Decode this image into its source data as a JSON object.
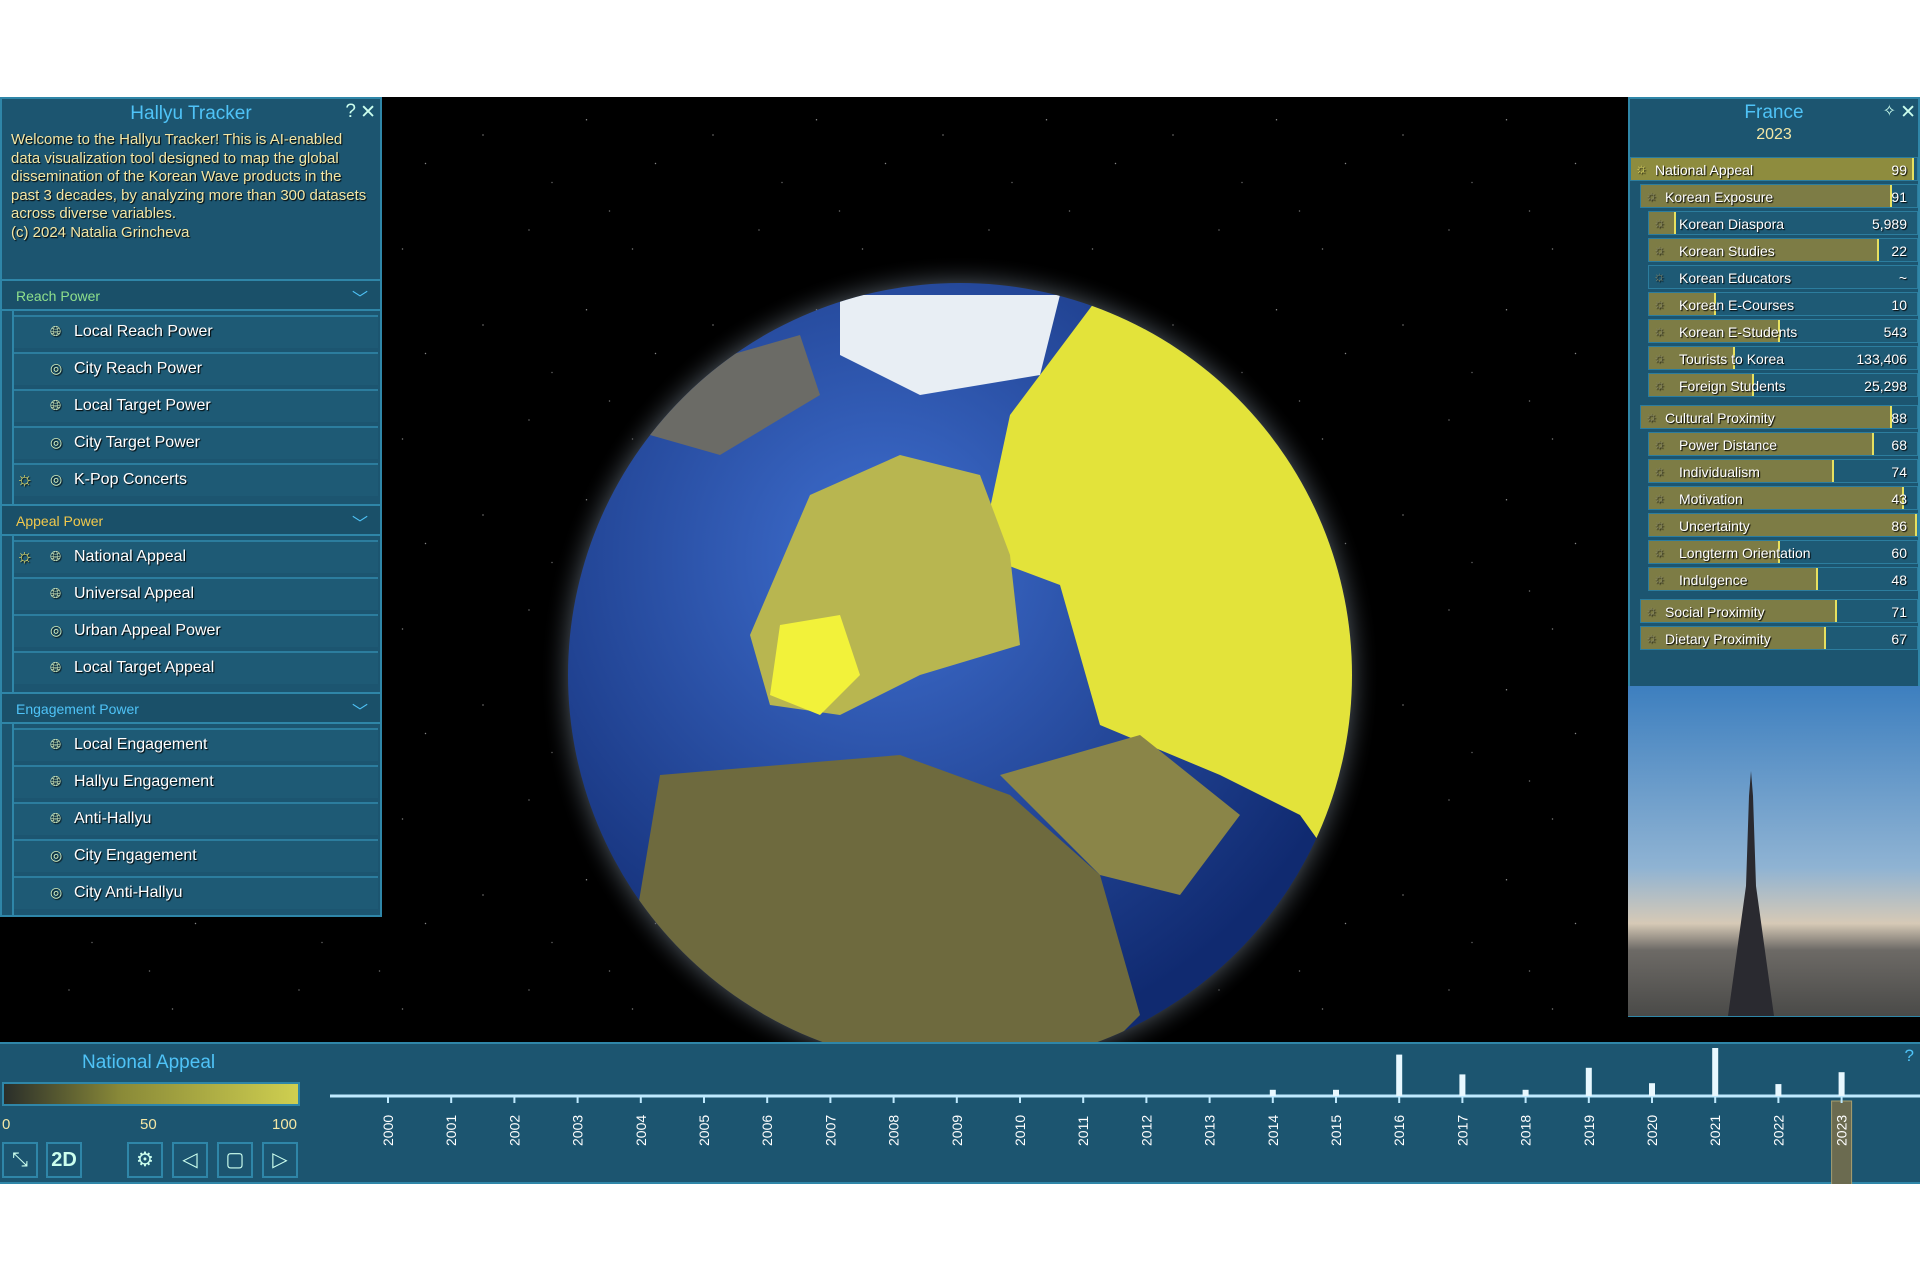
{
  "left_panel": {
    "title": "Hallyu Tracker",
    "help_icon": "?",
    "close_icon": "✕",
    "welcome": "Welcome to the Hallyu Tracker! This is AI-enabled data visualization tool designed to map the global dissemination of the Korean Wave products in the past 3 decades, by analyzing more than 300 datasets across diverse variables.",
    "copyright": "(c) 2024 Natalia Grincheva",
    "sections": [
      {
        "label": "Reach Power",
        "color": "#8fe08c",
        "items": [
          {
            "label": "Local Reach Power",
            "icon": "globe-icon",
            "active": false
          },
          {
            "label": "City Reach Power",
            "icon": "location-pin-icon",
            "active": false
          },
          {
            "label": "Local Target Power",
            "icon": "globe-icon",
            "active": false
          },
          {
            "label": "City Target Power",
            "icon": "location-pin-icon",
            "active": false
          },
          {
            "label": "K-Pop Concerts",
            "icon": "location-pin-icon",
            "active": true
          }
        ]
      },
      {
        "label": "Appeal Power",
        "color": "#f2c94c",
        "items": [
          {
            "label": "National Appeal",
            "icon": "globe-icon",
            "active": true
          },
          {
            "label": "Universal Appeal",
            "icon": "globe-icon",
            "active": false
          },
          {
            "label": "Urban Appeal Power",
            "icon": "location-pin-icon",
            "active": false
          },
          {
            "label": "Local Target Appeal",
            "icon": "globe-icon",
            "active": false
          }
        ]
      },
      {
        "label": "Engagement Power",
        "color": "#4fc3f7",
        "items": [
          {
            "label": "Local Engagement",
            "icon": "globe-icon",
            "active": false
          },
          {
            "label": "Hallyu Engagement",
            "icon": "globe-icon",
            "active": false
          },
          {
            "label": "Anti-Hallyu",
            "icon": "globe-icon",
            "active": false
          },
          {
            "label": "City Engagement",
            "icon": "location-pin-icon",
            "active": false
          },
          {
            "label": "City Anti-Hallyu",
            "icon": "location-pin-icon",
            "active": false
          }
        ]
      }
    ]
  },
  "right_panel": {
    "country": "France",
    "year": "2023",
    "rows": [
      {
        "label": "National Appeal",
        "value": "99",
        "level": 0,
        "fill": 0.99,
        "top": true
      },
      {
        "label": "Korean Exposure",
        "value": "91",
        "level": 1,
        "fill": 0.91
      },
      {
        "label": "Korean Diaspora",
        "value": "5,989",
        "level": 2,
        "fill": 0.1
      },
      {
        "label": "Korean Studies",
        "value": "22",
        "level": 2,
        "fill": 0.86
      },
      {
        "label": "Korean Educators",
        "value": "~",
        "level": 2,
        "fill": 0
      },
      {
        "label": "Korean E-Courses",
        "value": "10",
        "level": 2,
        "fill": 0.25
      },
      {
        "label": "Korean E-Students",
        "value": "543",
        "level": 2,
        "fill": 0.49
      },
      {
        "label": "Tourists to Korea",
        "value": "133,406",
        "level": 2,
        "fill": 0.32
      },
      {
        "label": "Foreign Students",
        "value": "25,298",
        "level": 2,
        "fill": 0.39
      },
      {
        "label": "Cultural Proximity",
        "value": "88",
        "level": 1,
        "fill": 0.91
      },
      {
        "label": "Power Distance",
        "value": "68",
        "level": 2,
        "fill": 0.84
      },
      {
        "label": "Individualism",
        "value": "74",
        "level": 2,
        "fill": 0.69
      },
      {
        "label": "Motivation",
        "value": "43",
        "level": 2,
        "fill": 0.95
      },
      {
        "label": "Uncertainty",
        "value": "86",
        "level": 2,
        "fill": 1.0
      },
      {
        "label": "Longterm Orientation",
        "value": "60",
        "level": 2,
        "fill": 0.49
      },
      {
        "label": "Indulgence",
        "value": "48",
        "level": 2,
        "fill": 0.63
      },
      {
        "label": "Social Proximity",
        "value": "71",
        "level": 1,
        "fill": 0.71
      },
      {
        "label": "Dietary Proximity",
        "value": "67",
        "level": 1,
        "fill": 0.67
      }
    ]
  },
  "bottom": {
    "title": "National Appeal",
    "legend": {
      "min": "0",
      "mid": "50",
      "max": "100"
    },
    "buttons": {
      "collapse": "collapse-icon",
      "mode": "2D",
      "settings": "gear-icon",
      "prev": "play-back-icon",
      "stop": "stop-icon",
      "next": "play-icon"
    },
    "help_icon": "?",
    "timeline": {
      "years": [
        "2000",
        "2001",
        "2002",
        "2003",
        "2004",
        "2005",
        "2006",
        "2007",
        "2008",
        "2009",
        "2010",
        "2011",
        "2012",
        "2013",
        "2014",
        "2015",
        "2016",
        "2017",
        "2018",
        "2019",
        "2020",
        "2021",
        "2022",
        "2023"
      ],
      "levels": [
        0,
        0,
        0,
        0,
        0,
        0,
        0,
        0,
        0,
        0,
        0,
        0,
        0,
        0,
        5,
        5,
        85,
        40,
        5,
        55,
        20,
        100,
        18,
        45
      ],
      "selected": "2023"
    }
  },
  "colors": {
    "accent": "#4fc3f7",
    "panel": "#1c5570",
    "appeal_high": "#e6e060"
  }
}
